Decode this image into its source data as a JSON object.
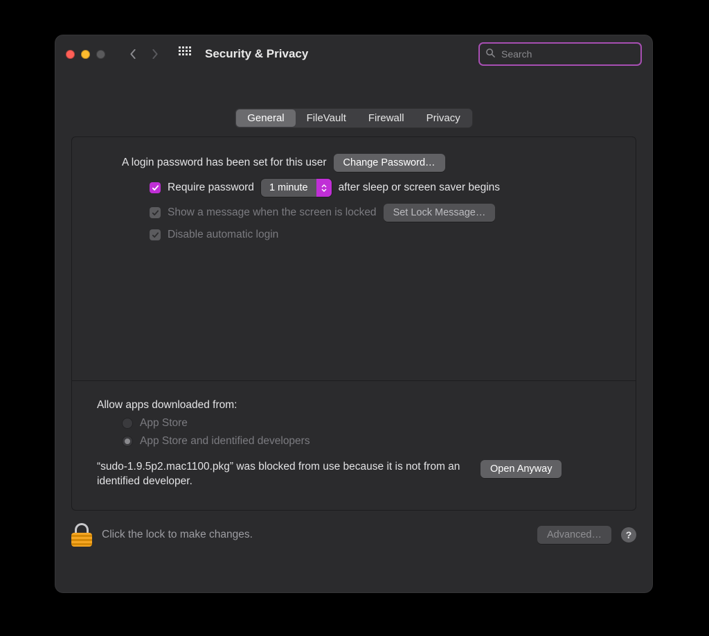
{
  "window": {
    "title": "Security & Privacy"
  },
  "search": {
    "placeholder": "Search"
  },
  "tabs": {
    "general": "General",
    "filevault": "FileVault",
    "firewall": "Firewall",
    "privacy": "Privacy",
    "selected": "general"
  },
  "general": {
    "login_password_set": "A login password has been set for this user",
    "change_password": "Change Password…",
    "require_password_label_left": "Require password",
    "require_password_delay": "1 minute",
    "require_password_label_right": "after sleep or screen saver begins",
    "show_message_label": "Show a message when the screen is locked",
    "set_lock_message": "Set Lock Message…",
    "disable_auto_login": "Disable automatic login",
    "allow_apps_header": "Allow apps downloaded from:",
    "source_app_store": "App Store",
    "source_identified": "App Store and identified developers",
    "blocked_message": "“sudo-1.9.5p2.mac1100.pkg” was blocked from use because it is not from an identified developer.",
    "open_anyway": "Open Anyway"
  },
  "footer": {
    "lock_hint": "Click the lock to make changes.",
    "advanced": "Advanced…",
    "help": "?"
  },
  "colors": {
    "accent": "#c02fd6"
  }
}
